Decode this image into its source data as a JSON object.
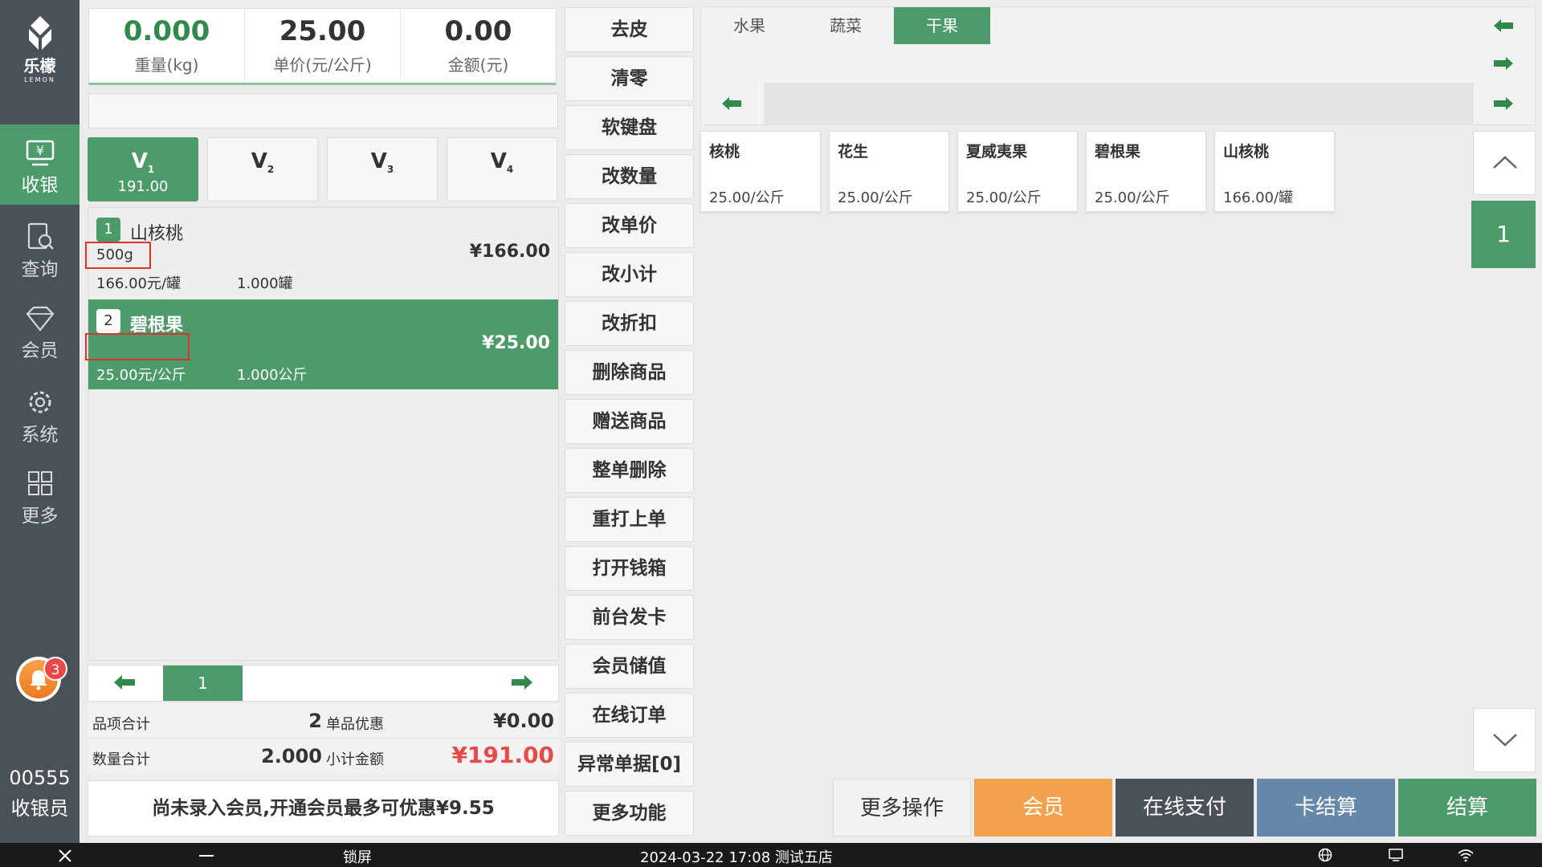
{
  "sidebar": {
    "logo_cn": "乐檬",
    "logo_en": "LEMON",
    "nav": [
      {
        "label": "收银",
        "icon": "cash-register-icon",
        "active": true
      },
      {
        "label": "查询",
        "icon": "search-doc-icon",
        "active": false
      },
      {
        "label": "会员",
        "icon": "diamond-icon",
        "active": false
      },
      {
        "label": "系统",
        "icon": "gear-icon",
        "active": false
      },
      {
        "label": "更多",
        "icon": "grid-icon",
        "active": false
      }
    ],
    "notification_count": "3",
    "cashier_id": "00555",
    "cashier_role": "收银员"
  },
  "scale": {
    "weight": "0.000",
    "weight_label": "重量(kg)",
    "unit_price": "25.00",
    "unit_price_label": "单价(元/公斤)",
    "amount": "0.00",
    "amount_label": "金额(元)"
  },
  "barcode_input": {
    "value": "",
    "placeholder": ""
  },
  "vtabs": [
    {
      "name": "V",
      "sub": "1",
      "amount": "191.00",
      "active": true
    },
    {
      "name": "V",
      "sub": "2",
      "amount": "",
      "active": false
    },
    {
      "name": "V",
      "sub": "3",
      "amount": "",
      "active": false
    },
    {
      "name": "V",
      "sub": "4",
      "amount": "",
      "active": false
    }
  ],
  "order_items": [
    {
      "num": "1",
      "name": "山核桃",
      "spec": "500g",
      "price": "166.00元/罐",
      "qty": "1.000罐",
      "total": "¥166.00",
      "selected": false
    },
    {
      "num": "2",
      "name": "碧根果",
      "spec": "",
      "price": "25.00元/公斤",
      "qty": "1.000公斤",
      "total": "¥25.00",
      "selected": true
    }
  ],
  "order_pager": {
    "page": "1"
  },
  "summary": {
    "items_label": "品项合计",
    "items_value": "2",
    "discount_label": "单品优惠",
    "discount_value": "¥0.00",
    "qty_label": "数量合计",
    "qty_value": "2.000",
    "subtotal_label": "小计金额",
    "subtotal_value": "¥191.00"
  },
  "member_tip": "尚未录入会员,开通会员最多可优惠¥9.55",
  "function_buttons": [
    "去皮",
    "清零",
    "软键盘",
    "改数量",
    "改单价",
    "改小计",
    "改折扣",
    "删除商品",
    "赠送商品",
    "整单删除",
    "重打上单",
    "打开钱箱",
    "前台发卡",
    "会员储值",
    "在线订单",
    "异常单据[0]",
    "更多功能"
  ],
  "categories": [
    {
      "label": "水果",
      "active": false
    },
    {
      "label": "蔬菜",
      "active": false
    },
    {
      "label": "干果",
      "active": true
    }
  ],
  "products": [
    {
      "name": "核桃",
      "price": "25.00/公斤"
    },
    {
      "name": "花生",
      "price": "25.00/公斤"
    },
    {
      "name": "夏威夷果",
      "price": "25.00/公斤"
    },
    {
      "name": "碧根果",
      "price": "25.00/公斤"
    },
    {
      "name": "山核桃",
      "price": "166.00/罐"
    }
  ],
  "product_page": "1",
  "pay_buttons": [
    {
      "label": "更多操作",
      "color": "#f2f2f2"
    },
    {
      "label": "会员",
      "color": "#f2a24e"
    },
    {
      "label": "在线支付",
      "color": "#4a5159"
    },
    {
      "label": "卡结算",
      "color": "#6687a7"
    },
    {
      "label": "结算",
      "color": "#4d9a6a"
    }
  ],
  "taskbar": {
    "lock_label": "锁屏",
    "status": "2024-03-22 17:08 测试五店"
  },
  "colors": {
    "accent": "#4d9a6a",
    "sidebar": "#4a5159",
    "danger": "#e84a4a"
  }
}
